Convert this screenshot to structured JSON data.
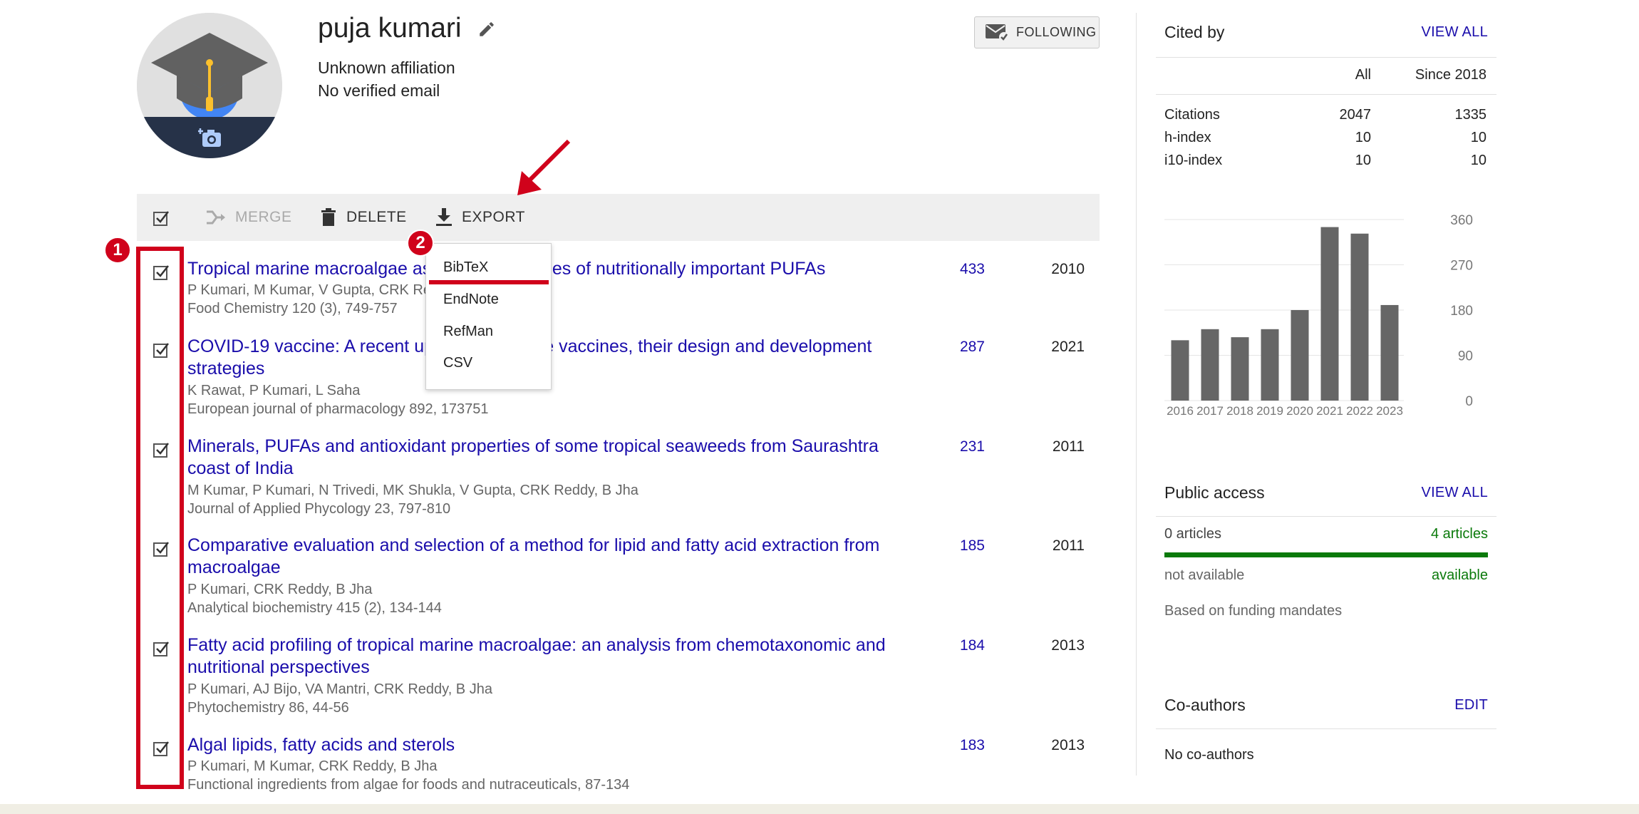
{
  "profile": {
    "name": "puja kumari",
    "affiliation": "Unknown affiliation",
    "email": "No verified email",
    "follow_label": "FOLLOWING"
  },
  "toolbar": {
    "merge_label": "MERGE",
    "delete_label": "DELETE",
    "export_label": "EXPORT"
  },
  "export_menu": {
    "items": [
      "BibTeX",
      "EndNote",
      "RefMan",
      "CSV"
    ]
  },
  "annotations": {
    "badge_1": "1",
    "badge_2": "2",
    "color": "#d0021b"
  },
  "articles": [
    {
      "title": "Tropical marine macroalgae as potential sources of nutritionally important PUFAs",
      "authors": "P Kumari, M Kumar, V Gupta, CRK Reddy, B Jha",
      "venue": "Food Chemistry 120 (3), 749-757",
      "cited_by": "433",
      "year": "2010",
      "checked": true
    },
    {
      "title": "COVID-19 vaccine: A recent update in pipeline vaccines, their design and development strategies",
      "authors": "K Rawat, P Kumari, L Saha",
      "venue": "European journal of pharmacology 892, 173751",
      "cited_by": "287",
      "year": "2021",
      "checked": true
    },
    {
      "title": "Minerals, PUFAs and antioxidant properties of some tropical seaweeds from Saurashtra coast of India",
      "authors": "M Kumar, P Kumari, N Trivedi, MK Shukla, V Gupta, CRK Reddy, B Jha",
      "venue": "Journal of Applied Phycology 23, 797-810",
      "cited_by": "231",
      "year": "2011",
      "checked": true
    },
    {
      "title": "Comparative evaluation and selection of a method for lipid and fatty acid extraction from macroalgae",
      "authors": "P Kumari, CRK Reddy, B Jha",
      "venue": "Analytical biochemistry 415 (2), 134-144",
      "cited_by": "185",
      "year": "2011",
      "checked": true
    },
    {
      "title": "Fatty acid profiling of tropical marine macroalgae: an analysis from chemotaxonomic and nutritional perspectives",
      "authors": "P Kumari, AJ Bijo, VA Mantri, CRK Reddy, B Jha",
      "venue": "Phytochemistry 86, 44-56",
      "cited_by": "184",
      "year": "2013",
      "checked": true
    },
    {
      "title": "Algal lipids, fatty acids and sterols",
      "authors": "P Kumari, M Kumar, CRK Reddy, B Jha",
      "venue": "Functional ingredients from algae for foods and nutraceuticals, 87-134",
      "cited_by": "183",
      "year": "2013",
      "checked": true
    }
  ],
  "cited_by": {
    "heading": "Cited by",
    "view_all": "VIEW ALL",
    "col_all": "All",
    "col_since": "Since 2018",
    "rows": [
      {
        "label": "Citations",
        "all": "2047",
        "since": "1335"
      },
      {
        "label": "h-index",
        "all": "10",
        "since": "10"
      },
      {
        "label": "i10-index",
        "all": "10",
        "since": "10"
      }
    ]
  },
  "chart_data": {
    "type": "bar",
    "categories": [
      "2016",
      "2017",
      "2018",
      "2019",
      "2020",
      "2021",
      "2022",
      "2023"
    ],
    "values": [
      120,
      142,
      126,
      142,
      180,
      345,
      332,
      190
    ],
    "ylim": [
      0,
      360
    ],
    "yticks": [
      "0",
      "90",
      "180",
      "270",
      "360"
    ],
    "bar_color": "#666666",
    "grid": true,
    "title": "",
    "xlabel": "",
    "ylabel": ""
  },
  "public_access": {
    "heading": "Public access",
    "view_all": "VIEW ALL",
    "left_count": "0 articles",
    "right_count": "4 articles",
    "left_status": "not available",
    "right_status": "available",
    "note": "Based on funding mandates",
    "available_fraction": 1.0
  },
  "coauthors": {
    "heading": "Co-authors",
    "edit_label": "EDIT",
    "empty_text": "No co-authors"
  }
}
